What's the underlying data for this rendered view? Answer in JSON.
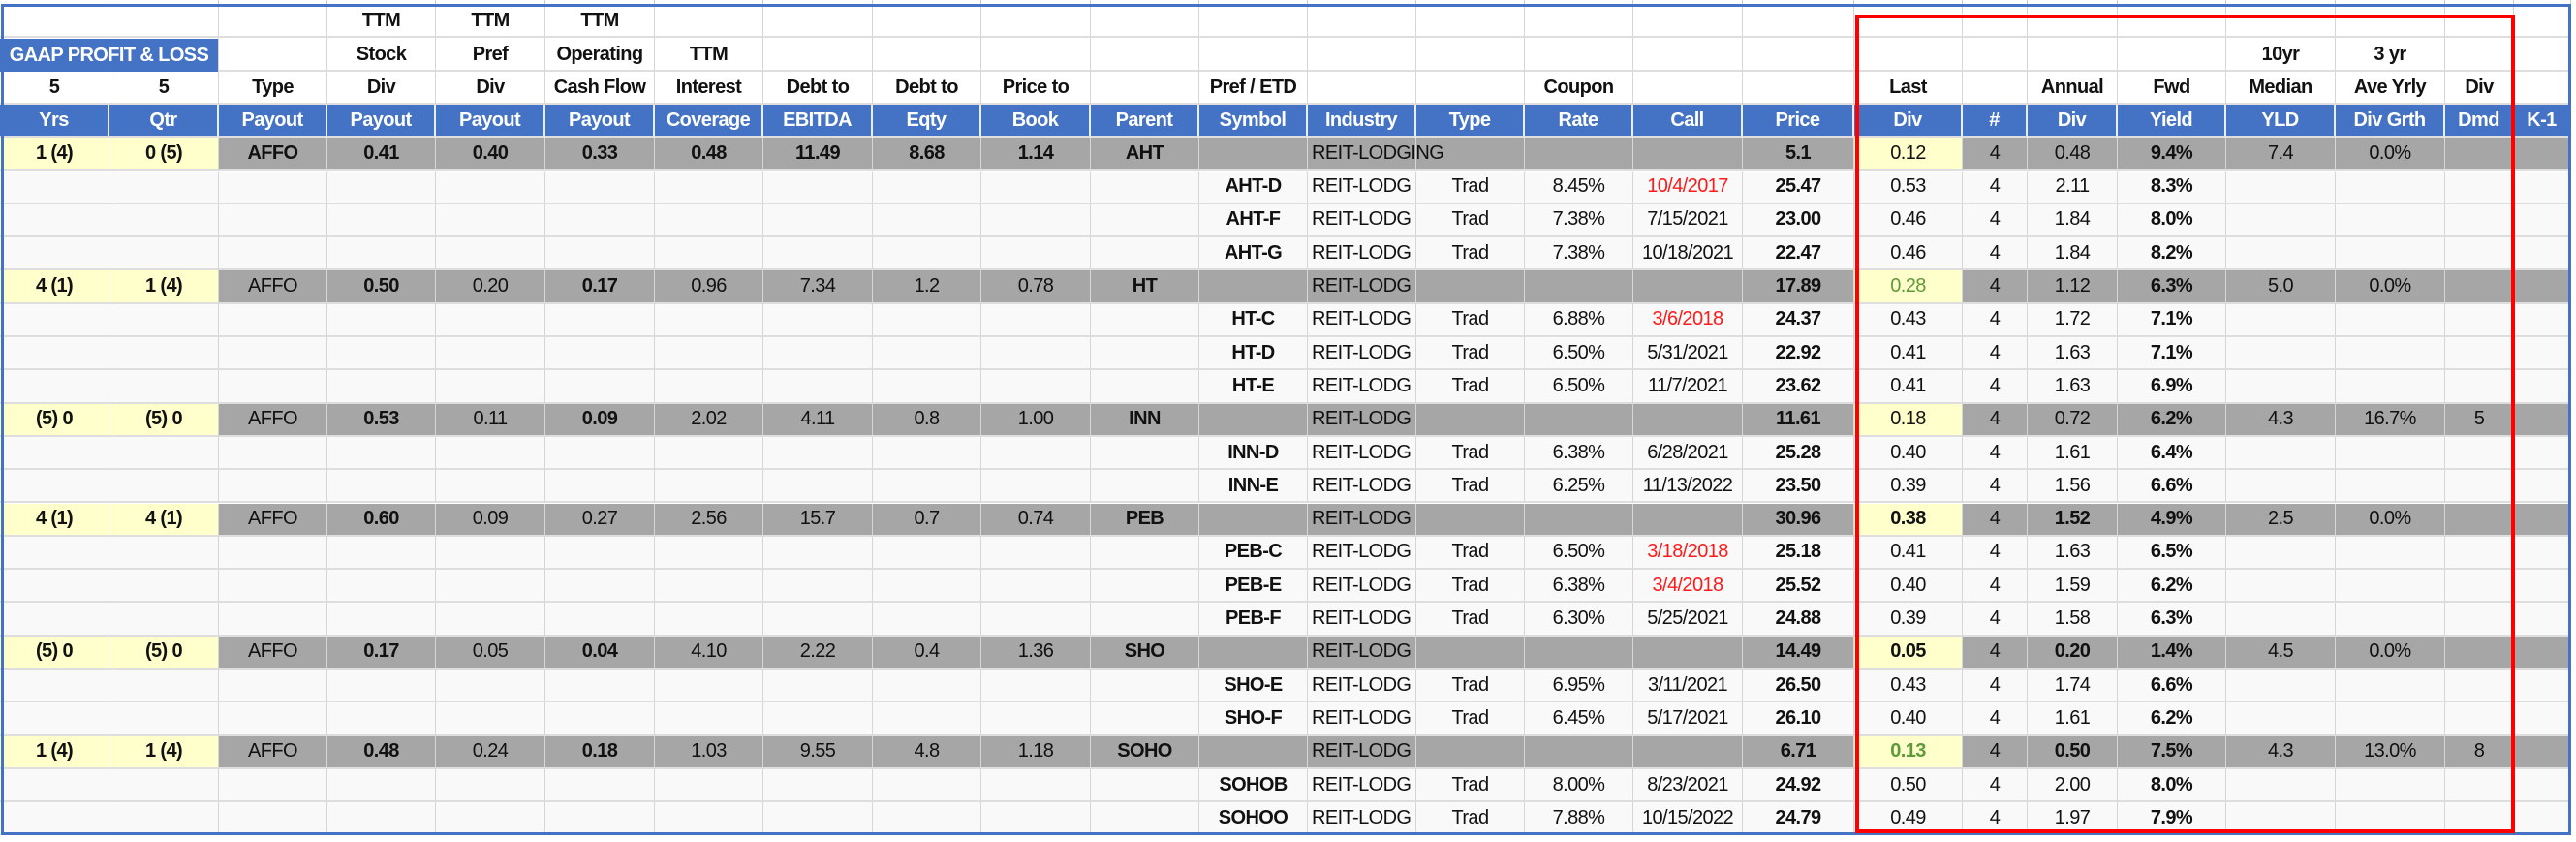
{
  "title_banner": "GAAP PROFIT & LOSS",
  "header_rows": [
    [
      "",
      "",
      "",
      "TTM",
      "TTM",
      "TTM",
      "",
      "",
      "",
      "",
      "",
      "",
      "",
      "",
      "",
      "",
      "",
      "",
      "",
      "",
      "",
      "",
      "",
      "",
      ""
    ],
    [
      "",
      "",
      "",
      "Stock",
      "Pref",
      "Operating",
      "TTM",
      "",
      "",
      "",
      "",
      "",
      "",
      "",
      "",
      "",
      "",
      "",
      "",
      "",
      "",
      "10yr",
      "3 yr",
      "",
      ""
    ],
    [
      "5",
      "5",
      "Type",
      "Div",
      "Div",
      "Cash Flow",
      "Interest",
      "Debt to",
      "Debt to",
      "Price to",
      "",
      "Pref / ETD",
      "",
      "",
      "Coupon",
      "",
      "",
      "Last",
      "",
      "Annual",
      "Fwd",
      "Median",
      "Ave Yrly",
      "Div",
      ""
    ]
  ],
  "column_headers": [
    "Yrs",
    "Qtr",
    "Payout",
    "Payout",
    "Payout",
    "Payout",
    "Coverage",
    "EBITDA",
    "Eqty",
    "Book",
    "Parent",
    "Symbol",
    "Industry",
    "Type",
    "Rate",
    "Call",
    "Price",
    "Div",
    "#",
    "Div",
    "Yield",
    "YLD",
    "Div Grth",
    "Dmd",
    "K-1"
  ],
  "colors": {
    "header_blue": "#4472c4",
    "parent_gray": "#a6a6a6",
    "highlight_yellow": "#ffffcc",
    "call_red": "#ff1a1a",
    "div_green": "#5f9a3a",
    "selection_red": "#ff0000"
  },
  "rows": [
    {
      "kind": "parent",
      "cells": [
        "1 (4)",
        "0 (5)",
        "AFFO",
        "0.41",
        "0.40",
        "0.33",
        "0.48",
        "11.49",
        "8.68",
        "1.14",
        "AHT",
        "",
        "REIT-LODGING",
        "",
        "",
        "",
        "5.1",
        "0.12",
        "4",
        "0.48",
        "9.4%",
        "7.4",
        "0.0%",
        "",
        ""
      ],
      "bold": [
        0,
        1,
        2,
        3,
        4,
        5,
        6,
        7,
        8,
        9,
        10,
        16,
        20
      ],
      "red": [],
      "green": []
    },
    {
      "kind": "child",
      "cells": [
        "",
        "",
        "",
        "",
        "",
        "",
        "",
        "",
        "",
        "",
        "",
        "AHT-D",
        "REIT-LODG",
        "Trad",
        "8.45%",
        "10/4/2017",
        "25.47",
        "0.53",
        "4",
        "2.11",
        "8.3%",
        "",
        "",
        "",
        ""
      ],
      "bold": [
        11,
        16,
        20
      ],
      "red": [
        15
      ],
      "green": []
    },
    {
      "kind": "child",
      "cells": [
        "",
        "",
        "",
        "",
        "",
        "",
        "",
        "",
        "",
        "",
        "",
        "AHT-F",
        "REIT-LODG",
        "Trad",
        "7.38%",
        "7/15/2021",
        "23.00",
        "0.46",
        "4",
        "1.84",
        "8.0%",
        "",
        "",
        "",
        ""
      ],
      "bold": [
        11,
        16,
        20
      ],
      "red": [],
      "green": []
    },
    {
      "kind": "child",
      "cells": [
        "",
        "",
        "",
        "",
        "",
        "",
        "",
        "",
        "",
        "",
        "",
        "AHT-G",
        "REIT-LODG",
        "Trad",
        "7.38%",
        "10/18/2021",
        "22.47",
        "0.46",
        "4",
        "1.84",
        "8.2%",
        "",
        "",
        "",
        ""
      ],
      "bold": [
        11,
        16,
        20
      ],
      "red": [],
      "green": []
    },
    {
      "kind": "parent",
      "cells": [
        "4 (1)",
        "1 (4)",
        "AFFO",
        "0.50",
        "0.20",
        "0.17",
        "0.96",
        "7.34",
        "1.2",
        "0.78",
        "HT",
        "",
        "REIT-LODG",
        "",
        "",
        "",
        "17.89",
        "0.28",
        "4",
        "1.12",
        "6.3%",
        "5.0",
        "0.0%",
        "",
        ""
      ],
      "bold": [
        0,
        1,
        3,
        5,
        10,
        16,
        20
      ],
      "red": [],
      "green": [
        17
      ]
    },
    {
      "kind": "child",
      "cells": [
        "",
        "",
        "",
        "",
        "",
        "",
        "",
        "",
        "",
        "",
        "",
        "HT-C",
        "REIT-LODG",
        "Trad",
        "6.88%",
        "3/6/2018",
        "24.37",
        "0.43",
        "4",
        "1.72",
        "7.1%",
        "",
        "",
        "",
        ""
      ],
      "bold": [
        11,
        16,
        20
      ],
      "red": [
        15
      ],
      "green": []
    },
    {
      "kind": "child",
      "cells": [
        "",
        "",
        "",
        "",
        "",
        "",
        "",
        "",
        "",
        "",
        "",
        "HT-D",
        "REIT-LODG",
        "Trad",
        "6.50%",
        "5/31/2021",
        "22.92",
        "0.41",
        "4",
        "1.63",
        "7.1%",
        "",
        "",
        "",
        ""
      ],
      "bold": [
        11,
        16,
        20
      ],
      "red": [],
      "green": []
    },
    {
      "kind": "child",
      "cells": [
        "",
        "",
        "",
        "",
        "",
        "",
        "",
        "",
        "",
        "",
        "",
        "HT-E",
        "REIT-LODG",
        "Trad",
        "6.50%",
        "11/7/2021",
        "23.62",
        "0.41",
        "4",
        "1.63",
        "6.9%",
        "",
        "",
        "",
        ""
      ],
      "bold": [
        11,
        16,
        20
      ],
      "red": [],
      "green": []
    },
    {
      "kind": "parent",
      "cells": [
        "(5) 0",
        "(5) 0",
        "AFFO",
        "0.53",
        "0.11",
        "0.09",
        "2.02",
        "4.11",
        "0.8",
        "1.00",
        "INN",
        "",
        "REIT-LODG",
        "",
        "",
        "",
        "11.61",
        "0.18",
        "4",
        "0.72",
        "6.2%",
        "4.3",
        "16.7%",
        "5",
        ""
      ],
      "bold": [
        0,
        1,
        3,
        5,
        10,
        16,
        20
      ],
      "red": [],
      "green": []
    },
    {
      "kind": "child",
      "cells": [
        "",
        "",
        "",
        "",
        "",
        "",
        "",
        "",
        "",
        "",
        "",
        "INN-D",
        "REIT-LODG",
        "Trad",
        "6.38%",
        "6/28/2021",
        "25.28",
        "0.40",
        "4",
        "1.61",
        "6.4%",
        "",
        "",
        "",
        ""
      ],
      "bold": [
        11,
        16,
        20
      ],
      "red": [],
      "green": []
    },
    {
      "kind": "child",
      "cells": [
        "",
        "",
        "",
        "",
        "",
        "",
        "",
        "",
        "",
        "",
        "",
        "INN-E",
        "REIT-LODG",
        "Trad",
        "6.25%",
        "11/13/2022",
        "23.50",
        "0.39",
        "4",
        "1.56",
        "6.6%",
        "",
        "",
        "",
        ""
      ],
      "bold": [
        11,
        16,
        20
      ],
      "red": [],
      "green": []
    },
    {
      "kind": "parent",
      "cells": [
        "4 (1)",
        "4 (1)",
        "AFFO",
        "0.60",
        "0.09",
        "0.27",
        "2.56",
        "15.7",
        "0.7",
        "0.74",
        "PEB",
        "",
        "REIT-LODG",
        "",
        "",
        "",
        "30.96",
        "0.38",
        "4",
        "1.52",
        "4.9%",
        "2.5",
        "0.0%",
        "",
        ""
      ],
      "bold": [
        0,
        1,
        3,
        10,
        16,
        17,
        19,
        20
      ],
      "red": [],
      "green": []
    },
    {
      "kind": "child",
      "cells": [
        "",
        "",
        "",
        "",
        "",
        "",
        "",
        "",
        "",
        "",
        "",
        "PEB-C",
        "REIT-LODG",
        "Trad",
        "6.50%",
        "3/18/2018",
        "25.18",
        "0.41",
        "4",
        "1.63",
        "6.5%",
        "",
        "",
        "",
        ""
      ],
      "bold": [
        11,
        16,
        20
      ],
      "red": [
        15
      ],
      "green": []
    },
    {
      "kind": "child",
      "cells": [
        "",
        "",
        "",
        "",
        "",
        "",
        "",
        "",
        "",
        "",
        "",
        "PEB-E",
        "REIT-LODG",
        "Trad",
        "6.38%",
        "3/4/2018",
        "25.52",
        "0.40",
        "4",
        "1.59",
        "6.2%",
        "",
        "",
        "",
        ""
      ],
      "bold": [
        11,
        16,
        20
      ],
      "red": [
        15
      ],
      "green": []
    },
    {
      "kind": "child",
      "cells": [
        "",
        "",
        "",
        "",
        "",
        "",
        "",
        "",
        "",
        "",
        "",
        "PEB-F",
        "REIT-LODG",
        "Trad",
        "6.30%",
        "5/25/2021",
        "24.88",
        "0.39",
        "4",
        "1.58",
        "6.3%",
        "",
        "",
        "",
        ""
      ],
      "bold": [
        11,
        16,
        20
      ],
      "red": [],
      "green": []
    },
    {
      "kind": "parent",
      "cells": [
        "(5) 0",
        "(5) 0",
        "AFFO",
        "0.17",
        "0.05",
        "0.04",
        "4.10",
        "2.22",
        "0.4",
        "1.36",
        "SHO",
        "",
        "REIT-LODG",
        "",
        "",
        "",
        "14.49",
        "0.05",
        "4",
        "0.20",
        "1.4%",
        "4.5",
        "0.0%",
        "",
        ""
      ],
      "bold": [
        0,
        1,
        3,
        5,
        10,
        16,
        17,
        19,
        20
      ],
      "red": [],
      "green": []
    },
    {
      "kind": "child",
      "cells": [
        "",
        "",
        "",
        "",
        "",
        "",
        "",
        "",
        "",
        "",
        "",
        "SHO-E",
        "REIT-LODG",
        "Trad",
        "6.95%",
        "3/11/2021",
        "26.50",
        "0.43",
        "4",
        "1.74",
        "6.6%",
        "",
        "",
        "",
        ""
      ],
      "bold": [
        11,
        16,
        20
      ],
      "red": [],
      "green": []
    },
    {
      "kind": "child",
      "cells": [
        "",
        "",
        "",
        "",
        "",
        "",
        "",
        "",
        "",
        "",
        "",
        "SHO-F",
        "REIT-LODG",
        "Trad",
        "6.45%",
        "5/17/2021",
        "26.10",
        "0.40",
        "4",
        "1.61",
        "6.2%",
        "",
        "",
        "",
        ""
      ],
      "bold": [
        11,
        16,
        20
      ],
      "red": [],
      "green": []
    },
    {
      "kind": "parent",
      "cells": [
        "1 (4)",
        "1 (4)",
        "AFFO",
        "0.48",
        "0.24",
        "0.18",
        "1.03",
        "9.55",
        "4.8",
        "1.18",
        "SOHO",
        "",
        "REIT-LODG",
        "",
        "",
        "",
        "6.71",
        "0.13",
        "4",
        "0.50",
        "7.5%",
        "4.3",
        "13.0%",
        "8",
        ""
      ],
      "bold": [
        0,
        1,
        3,
        5,
        10,
        16,
        17,
        19,
        20
      ],
      "red": [],
      "green": [
        17
      ]
    },
    {
      "kind": "child",
      "cells": [
        "",
        "",
        "",
        "",
        "",
        "",
        "",
        "",
        "",
        "",
        "",
        "SOHOB",
        "REIT-LODG",
        "Trad",
        "8.00%",
        "8/23/2021",
        "24.92",
        "0.50",
        "4",
        "2.00",
        "8.0%",
        "",
        "",
        "",
        ""
      ],
      "bold": [
        11,
        16,
        20
      ],
      "red": [],
      "green": []
    },
    {
      "kind": "child",
      "cells": [
        "",
        "",
        "",
        "",
        "",
        "",
        "",
        "",
        "",
        "",
        "",
        "SOHOO",
        "REIT-LODG",
        "Trad",
        "7.88%",
        "10/15/2022",
        "24.79",
        "0.49",
        "4",
        "1.97",
        "7.9%",
        "",
        "",
        "",
        ""
      ],
      "bold": [
        11,
        16,
        20
      ],
      "red": [],
      "green": []
    }
  ]
}
